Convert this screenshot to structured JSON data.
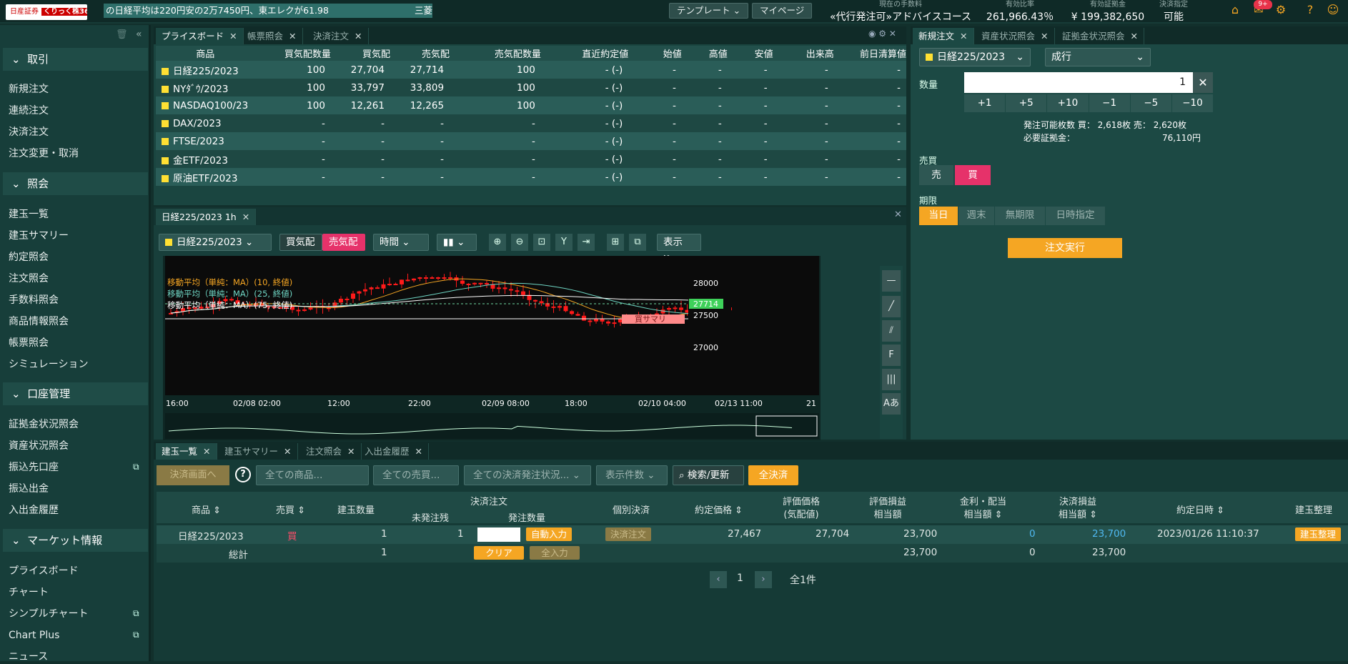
{
  "header": {
    "logo_text": "日産証券",
    "logo_badge": "くりっく株365",
    "ticker": "の日経平均は220円安の2万7450円、東エレクが61.98",
    "ticker_cont": "三菱",
    "template_btn": "テンプレート ⌄",
    "mypage_btn": "マイページ",
    "stats": [
      {
        "label": "現在の手数料",
        "value": "«代行発注可»アドバイスコース"
      },
      {
        "label": "有効比率",
        "value": "261,966.43％"
      },
      {
        "label": "有効証拠金",
        "value": "¥ 199,382,650"
      },
      {
        "label": "決済指定",
        "value": "可能"
      }
    ],
    "mail_badge": "9+"
  },
  "sidebar": {
    "sections": [
      {
        "title": "取引",
        "items": [
          "新規注文",
          "連続注文",
          "決済注文",
          "注文変更・取消"
        ]
      },
      {
        "title": "照会",
        "items": [
          "建玉一覧",
          "建玉サマリー",
          "約定照会",
          "注文照会",
          "手数料照会",
          "商品情報照会",
          "帳票照会",
          "シミュレーション"
        ]
      },
      {
        "title": "口座管理",
        "items": [
          "証拠金状況照会",
          "資産状況照会",
          "振込先口座",
          "振込出金",
          "入出金履歴"
        ]
      },
      {
        "title": "マーケット情報",
        "items": [
          "プライスボード",
          "チャート",
          "シンプルチャート",
          "Chart Plus",
          "ニュース"
        ]
      }
    ]
  },
  "priceboard": {
    "tabs": [
      "プライスボード",
      "帳票照会",
      "決済注文"
    ],
    "columns": [
      "商品",
      "買気配数量",
      "買気配",
      "売気配",
      "売気配数量",
      "直近約定値",
      "始値",
      "高値",
      "安値",
      "出来高",
      "前日清算値"
    ],
    "rows": [
      [
        "日経225/2023",
        "100",
        "27,704",
        "27,714",
        "100",
        "- (-)",
        "-",
        "-",
        "-",
        "-",
        "-"
      ],
      [
        "NYﾀﾞｳ/2023",
        "100",
        "33,797",
        "33,809",
        "100",
        "- (-)",
        "-",
        "-",
        "-",
        "-",
        "-"
      ],
      [
        "NASDAQ100/23",
        "100",
        "12,261",
        "12,265",
        "100",
        "- (-)",
        "-",
        "-",
        "-",
        "-",
        "-"
      ],
      [
        "DAX/2023",
        "-",
        "-",
        "-",
        "-",
        "- (-)",
        "-",
        "-",
        "-",
        "-",
        "-"
      ],
      [
        "FTSE/2023",
        "-",
        "-",
        "-",
        "-",
        "- (-)",
        "-",
        "-",
        "-",
        "-",
        "-"
      ],
      [
        "金ETF/2023",
        "-",
        "-",
        "-",
        "-",
        "- (-)",
        "-",
        "-",
        "-",
        "-",
        "-"
      ],
      [
        "原油ETF/2023",
        "-",
        "-",
        "-",
        "-",
        "- (-)",
        "-",
        "-",
        "-",
        "-",
        "-"
      ]
    ]
  },
  "chart": {
    "tab": "日経225/2023 1h",
    "symbol": "日経225/2023",
    "bid_btn": "買気配",
    "ask_btn": "売気配",
    "period": "時間",
    "display": "表示 ≫",
    "legend": [
      "移動平均（単純：MA）(10, 終値)",
      "移動平均（単純：MA）(25, 終値)",
      "移動平均（単純：MA）(75, 終値)"
    ],
    "price_labels": [
      "28000",
      "27714",
      "27500",
      "27000"
    ],
    "xlabels": [
      "16:00",
      "02/08 02:00",
      "12:00",
      "22:00",
      "02/09 08:00",
      "18:00",
      "02/10 04:00",
      "02/13 11:00",
      "21"
    ],
    "summary_label": "買サマリ",
    "colors": {
      "ma10": "#f5a623",
      "ma25": "#6fd6c4",
      "ma75": "#ffffff",
      "candle": "#ff1a1a"
    }
  },
  "order": {
    "tabs": [
      "新規注文",
      "資産状況照会",
      "証拠金状況照会"
    ],
    "symbol": "日経225/2023",
    "type": "成行",
    "qty_label": "数量",
    "qty": "1",
    "steps": [
      "+1",
      "+5",
      "+10",
      "−1",
      "−5",
      "−10"
    ],
    "available": "発注可能枚数 買：",
    "available_buy": "2,618枚",
    "available_sell_label": "売：",
    "available_sell": "2,620枚",
    "margin_label": "必要証拠金：",
    "margin": "76,110円",
    "side_label": "売買",
    "sell": "売",
    "buy": "買",
    "term_label": "期限",
    "terms": [
      "当日",
      "週末",
      "無期限",
      "日時指定"
    ],
    "submit": "注文実行"
  },
  "positions": {
    "tabs": [
      "建玉一覧",
      "建玉サマリー",
      "注文照会",
      "入出金履歴"
    ],
    "settle_screen": "決済画面へ",
    "filters": [
      "全ての商品...",
      "全ての売買...",
      "全ての決済発注状況... ⌄",
      "表示件数 ⌄"
    ],
    "search": "⌕ 検索/更新",
    "all_settle": "全決済",
    "columns": [
      "商品 ⇕",
      "売買 ⇕",
      "建玉数量",
      "決済注文",
      "未発注残",
      "発注数量",
      "個別決済",
      "約定価格 ⇕",
      "評価価格",
      "(気配値)",
      "評価損益",
      "相当額",
      "金利・配当",
      "相当額 ⇕",
      "決済損益",
      "相当額 ⇕",
      "約定日時 ⇕",
      "建玉整理"
    ],
    "row": {
      "product": "日経225/2023",
      "side": "買",
      "qty": "1",
      "remaining": "1",
      "auto": "自動入力",
      "settle": "決済注文",
      "price": "27,467",
      "eval": "27,704",
      "pl": "23,700",
      "interest": "0",
      "settle_pl": "23,700",
      "date": "2023/01/26 11:10:37",
      "arrange": "建玉整理"
    },
    "total": {
      "label": "総計",
      "qty": "1",
      "clear": "クリア",
      "all_input": "全入力",
      "pl": "23,700",
      "interest": "0",
      "settle_pl": "23,700"
    },
    "page": "1",
    "count": "全1件"
  }
}
